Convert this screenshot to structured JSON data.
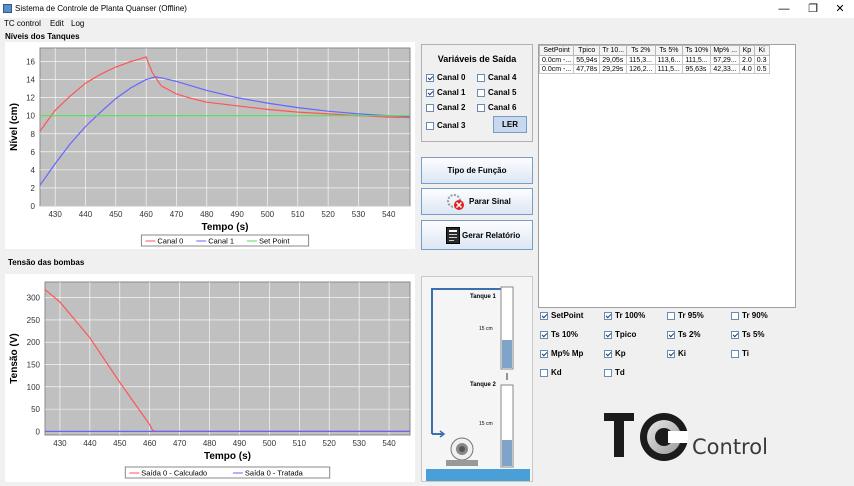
{
  "window": {
    "title": "Sistema de Controle de Planta Quanser (Offline)",
    "minimize": "—",
    "restore": "❐",
    "close": "✕"
  },
  "menu": {
    "items": [
      "TC control",
      "Edit",
      "Log"
    ]
  },
  "tank_levels": {
    "section_label": "Níveis dos Tanques",
    "chart_data": {
      "type": "line",
      "title": "",
      "xlabel": "Tempo (s)",
      "ylabel": "Nível (cm)",
      "xlim": [
        425,
        547
      ],
      "ylim": [
        0,
        17.5
      ],
      "xticks": [
        430,
        440,
        450,
        460,
        470,
        480,
        490,
        500,
        510,
        520,
        530,
        540
      ],
      "yticks": [
        0,
        2,
        4,
        6,
        8,
        10,
        12,
        14,
        16
      ],
      "grid": true,
      "legend": "bottom",
      "series": [
        {
          "name": "Canal 0",
          "color": "#ff5555",
          "x": [
            425,
            430,
            435,
            440,
            445,
            450,
            455,
            459,
            460,
            462,
            465,
            470,
            475,
            480,
            490,
            500,
            510,
            520,
            530,
            540,
            547
          ],
          "y": [
            8.3,
            10.6,
            12.2,
            13.6,
            14.6,
            15.4,
            16.0,
            16.4,
            16.5,
            14.8,
            13.3,
            12.4,
            11.9,
            11.5,
            11.1,
            10.7,
            10.4,
            10.2,
            10.0,
            9.85,
            9.8
          ]
        },
        {
          "name": "Canal 1",
          "color": "#6666ff",
          "x": [
            425,
            430,
            435,
            440,
            445,
            450,
            455,
            460,
            463,
            465,
            470,
            475,
            480,
            490,
            500,
            510,
            520,
            530,
            540,
            547
          ],
          "y": [
            2.3,
            4.7,
            6.9,
            8.8,
            10.4,
            11.9,
            13.1,
            14.0,
            14.3,
            14.2,
            13.8,
            13.3,
            12.8,
            12.0,
            11.4,
            10.9,
            10.5,
            10.2,
            10.0,
            9.9
          ]
        },
        {
          "name": "Set Point",
          "color": "#55dd55",
          "x": [
            425,
            547
          ],
          "y": [
            10,
            10
          ]
        }
      ]
    }
  },
  "pump_voltage": {
    "section_label": "Tensão das bombas",
    "chart_data": {
      "type": "line",
      "title": "",
      "xlabel": "Tempo (s)",
      "ylabel": "Tensão (V)",
      "xlim": [
        425,
        547
      ],
      "ylim": [
        -8,
        335
      ],
      "xticks": [
        430,
        440,
        450,
        460,
        470,
        480,
        490,
        500,
        510,
        520,
        530,
        540
      ],
      "yticks": [
        0,
        50,
        100,
        150,
        200,
        250,
        300
      ],
      "grid": true,
      "legend": "bottom",
      "series": [
        {
          "name": "Saída 0 - Calculado",
          "color": "#ff5555",
          "x": [
            425,
            430,
            440,
            450,
            460,
            461,
            462,
            470,
            480,
            500,
            547
          ],
          "y": [
            318,
            290,
            210,
            110,
            15,
            2,
            0,
            0,
            0,
            0,
            0
          ]
        },
        {
          "name": "Saída 0 - Tratada",
          "color": "#6666ff",
          "x": [
            425,
            547
          ],
          "y": [
            0,
            0
          ]
        }
      ]
    }
  },
  "output_vars": {
    "title": "Variáveis de Saída",
    "channels": [
      {
        "label": "Canal 0",
        "checked": true
      },
      {
        "label": "Canal 4",
        "checked": false
      },
      {
        "label": "Canal 1",
        "checked": true
      },
      {
        "label": "Canal 5",
        "checked": false
      },
      {
        "label": "Canal 2",
        "checked": false
      },
      {
        "label": "Canal 6",
        "checked": false
      },
      {
        "label": "Canal 3",
        "checked": false
      }
    ],
    "read_button": "LER"
  },
  "buttons": {
    "function_type": "Tipo de Função",
    "stop_signal": "Parar Sinal",
    "generate_report": "Gerar Relatório"
  },
  "tanks": {
    "tank1_label": "Tanque 1",
    "tank1_scale": "15 cm",
    "tank2_label": "Tanque 2",
    "tank2_scale": "15 cm",
    "tank1_level": 0.35,
    "tank2_level": 0.33
  },
  "results_table": {
    "columns": [
      "SetPoint",
      "Tpico",
      "Tr 10...",
      "Ts 2%",
      "Ts 5%",
      "Ts 10%",
      "Mp% ...",
      "Kp",
      "Ki"
    ],
    "rows": [
      [
        "0.0cm -...",
        "55,94s",
        "29,05s",
        "115,3...",
        "113,6...",
        "111,5...",
        "57,29...",
        "2.0",
        "0.3"
      ],
      [
        "0.0cm -...",
        "47,78s",
        "29,29s",
        "126,2...",
        "111,5...",
        "95,63s",
        "42,33...",
        "4.0",
        "0.5"
      ]
    ]
  },
  "metrics": [
    {
      "label": "SetPoint",
      "checked": true
    },
    {
      "label": "Tr 100%",
      "checked": true
    },
    {
      "label": "Tr 95%",
      "checked": false
    },
    {
      "label": "Tr 90%",
      "checked": false
    },
    {
      "label": "Ts 10%",
      "checked": true
    },
    {
      "label": "Tpico",
      "checked": true
    },
    {
      "label": "Ts 2%",
      "checked": true
    },
    {
      "label": "Ts 5%",
      "checked": true
    },
    {
      "label": "Mp% Mp",
      "checked": true
    },
    {
      "label": "Kp",
      "checked": true
    },
    {
      "label": "Ki",
      "checked": true
    },
    {
      "label": "Ti",
      "checked": false
    },
    {
      "label": "Kd",
      "checked": false
    },
    {
      "label": "Td",
      "checked": false
    }
  ],
  "logo": {
    "text": "Control"
  }
}
